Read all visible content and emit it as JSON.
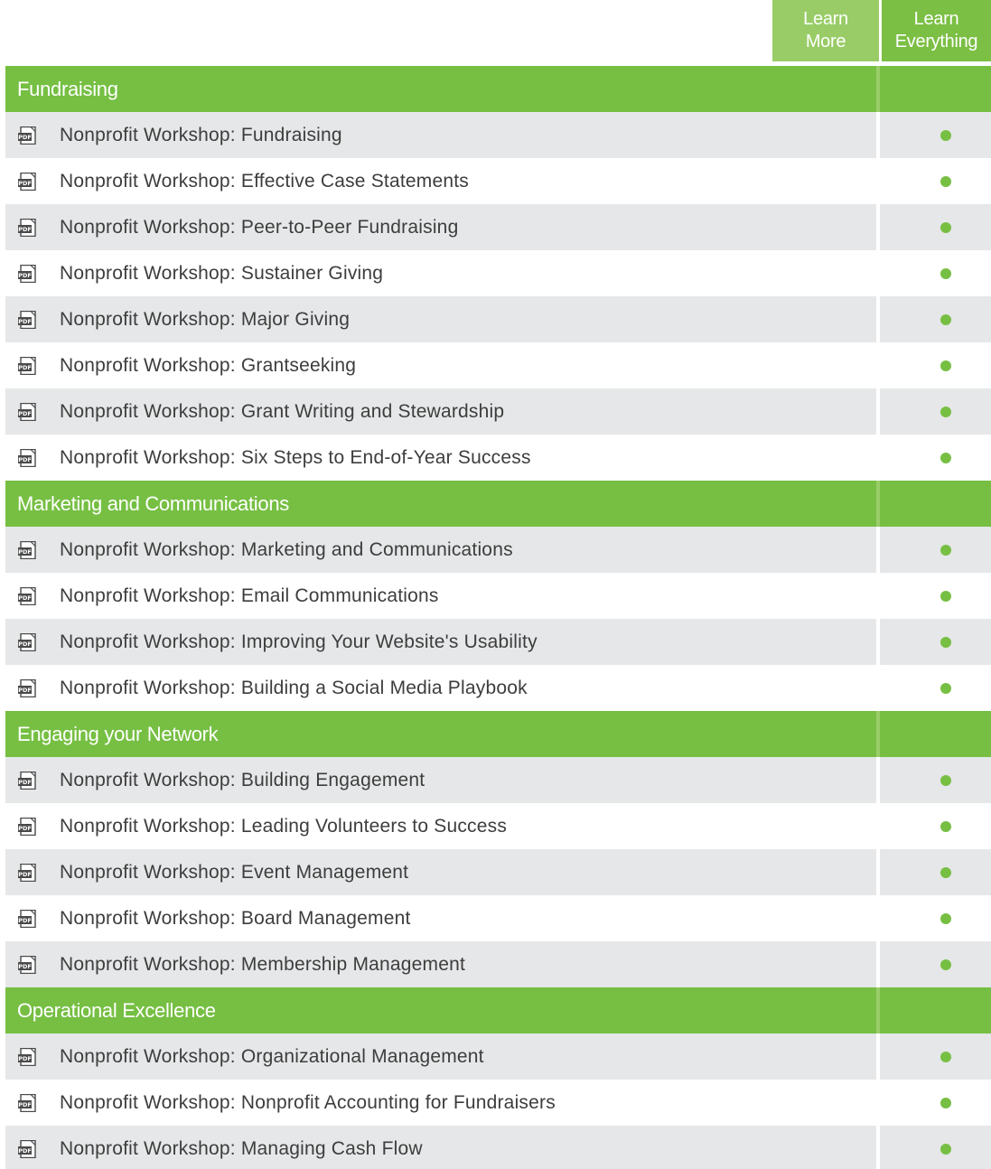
{
  "columns": {
    "learn_more": [
      "Learn",
      "More"
    ],
    "learn_everything": [
      "Learn",
      "Everything"
    ]
  },
  "accent_color": "#76bf43",
  "row_icon": "pdf-icon",
  "sections": [
    {
      "title": "Fundraising",
      "items": [
        {
          "title": "Nonprofit Workshop: Fundraising",
          "learn_everything": true
        },
        {
          "title": "Nonprofit Workshop: Effective Case Statements",
          "learn_everything": true
        },
        {
          "title": "Nonprofit Workshop: Peer-to-Peer Fundraising",
          "learn_everything": true
        },
        {
          "title": "Nonprofit Workshop: Sustainer Giving",
          "learn_everything": true
        },
        {
          "title": "Nonprofit Workshop: Major Giving",
          "learn_everything": true
        },
        {
          "title": "Nonprofit Workshop: Grantseeking",
          "learn_everything": true
        },
        {
          "title": "Nonprofit Workshop: Grant Writing and Stewardship",
          "learn_everything": true
        },
        {
          "title": "Nonprofit Workshop: Six Steps to End-of-Year Success",
          "learn_everything": true
        }
      ]
    },
    {
      "title": "Marketing and Communications",
      "items": [
        {
          "title": "Nonprofit Workshop: Marketing and Communications",
          "learn_everything": true
        },
        {
          "title": "Nonprofit Workshop: Email Communications",
          "learn_everything": true
        },
        {
          "title": "Nonprofit Workshop: Improving Your Website's Usability",
          "learn_everything": true
        },
        {
          "title": "Nonprofit Workshop: Building a Social Media Playbook",
          "learn_everything": true
        }
      ]
    },
    {
      "title": "Engaging your Network",
      "items": [
        {
          "title": "Nonprofit Workshop: Building Engagement",
          "learn_everything": true
        },
        {
          "title": "Nonprofit Workshop: Leading Volunteers to Success",
          "learn_everything": true
        },
        {
          "title": "Nonprofit Workshop: Event Management",
          "learn_everything": true
        },
        {
          "title": "Nonprofit Workshop: Board Management",
          "learn_everything": true
        },
        {
          "title": "Nonprofit Workshop: Membership Management",
          "learn_everything": true
        }
      ]
    },
    {
      "title": "Operational Excellence",
      "items": [
        {
          "title": "Nonprofit Workshop: Organizational Management",
          "learn_everything": true
        },
        {
          "title": "Nonprofit Workshop: Nonprofit Accounting for Fundraisers",
          "learn_everything": true
        },
        {
          "title": "Nonprofit Workshop: Managing Cash Flow",
          "learn_everything": true
        }
      ]
    }
  ]
}
